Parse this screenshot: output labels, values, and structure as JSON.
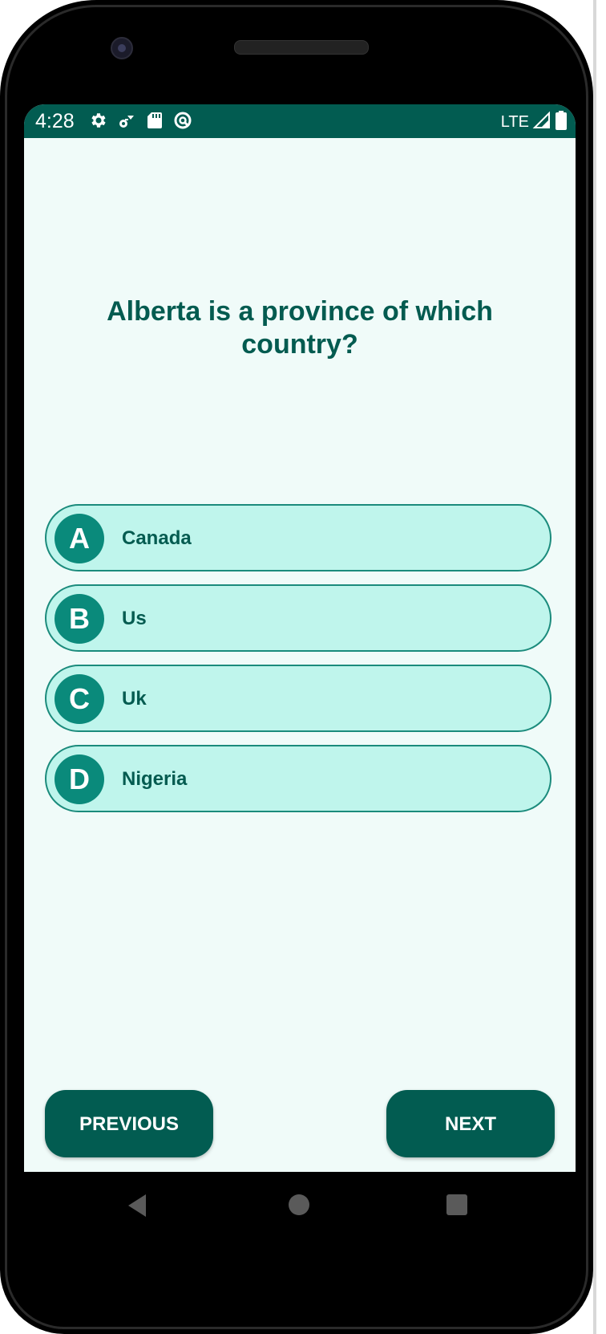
{
  "status_bar": {
    "time": "4:28",
    "network": "LTE",
    "icons_left": [
      "gear-icon",
      "signal-alt-icon",
      "sd-card-icon",
      "data-saver-icon"
    ],
    "icons_right": [
      "cell-signal-icon",
      "battery-icon"
    ]
  },
  "quiz": {
    "question": "Alberta is a province of which country?",
    "options": [
      {
        "letter": "A",
        "text": "Canada"
      },
      {
        "letter": "B",
        "text": "Us"
      },
      {
        "letter": "C",
        "text": "Uk"
      },
      {
        "letter": "D",
        "text": "Nigeria"
      }
    ]
  },
  "navigation": {
    "previous_label": "PREVIOUS",
    "next_label": "NEXT"
  },
  "colors": {
    "primary": "#025c51",
    "option_fill": "#bff5ec",
    "option_border": "#1b8b7c",
    "letter_circle": "#0a8a7b",
    "background": "#f0fbf9"
  }
}
